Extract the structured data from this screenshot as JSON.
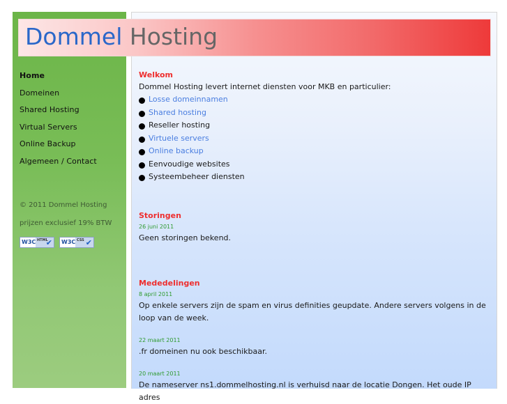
{
  "header": {
    "title_part1": "Dommel",
    "title_part2": "Hosting"
  },
  "sidebar": {
    "nav": [
      {
        "label": "Home",
        "active": true
      },
      {
        "label": "Domeinen"
      },
      {
        "label": "Shared Hosting"
      },
      {
        "label": "Virtual Servers"
      },
      {
        "label": "Online Backup"
      },
      {
        "label": "Algemeen / Contact"
      }
    ],
    "copyright": "© 2011 Dommel Hosting",
    "vat_note": "prijzen exclusief 19% BTW",
    "badges": [
      {
        "logo": "W3C",
        "kind": "HTML",
        "icon": "check-icon"
      },
      {
        "logo": "W3C",
        "kind": "CSS",
        "icon": "check-icon"
      }
    ]
  },
  "main": {
    "welcome": {
      "title": "Welkom",
      "intro": "Dommel Hosting levert internet diensten voor MKB en particulier:",
      "services": [
        {
          "label": "Losse domeinnamen",
          "link": true
        },
        {
          "label": "Shared hosting",
          "link": true
        },
        {
          "label": "Reseller hosting",
          "link": false
        },
        {
          "label": "Virtuele servers",
          "link": true
        },
        {
          "label": "Online backup",
          "link": true
        },
        {
          "label": "Eenvoudige websites",
          "link": false
        },
        {
          "label": "Systeembeheer diensten",
          "link": false
        }
      ]
    },
    "outages": {
      "title": "Storingen",
      "date": "26 juni 2011",
      "text": "Geen storingen bekend."
    },
    "news": {
      "title": "Mededelingen",
      "items": [
        {
          "date": "8 april 2011",
          "text": "Op enkele servers zijn de spam en virus definities geupdate. Andere servers volgens in de loop van de week."
        },
        {
          "date": "22 maart 2011",
          "text": ".fr domeinen nu ook beschikbaar."
        },
        {
          "date": "20 maart 2011",
          "text": "De nameserver ns1.dommelhosting.nl is verhuisd naar de locatie Dongen. Het oude IP adres"
        }
      ]
    }
  },
  "colors": {
    "brand_blue": "#2a67c9",
    "section_title_red": "#ee2e2e",
    "date_green": "#2e9a2e",
    "link_blue": "#4a7ee0",
    "sidebar_green": "#6cb548"
  }
}
